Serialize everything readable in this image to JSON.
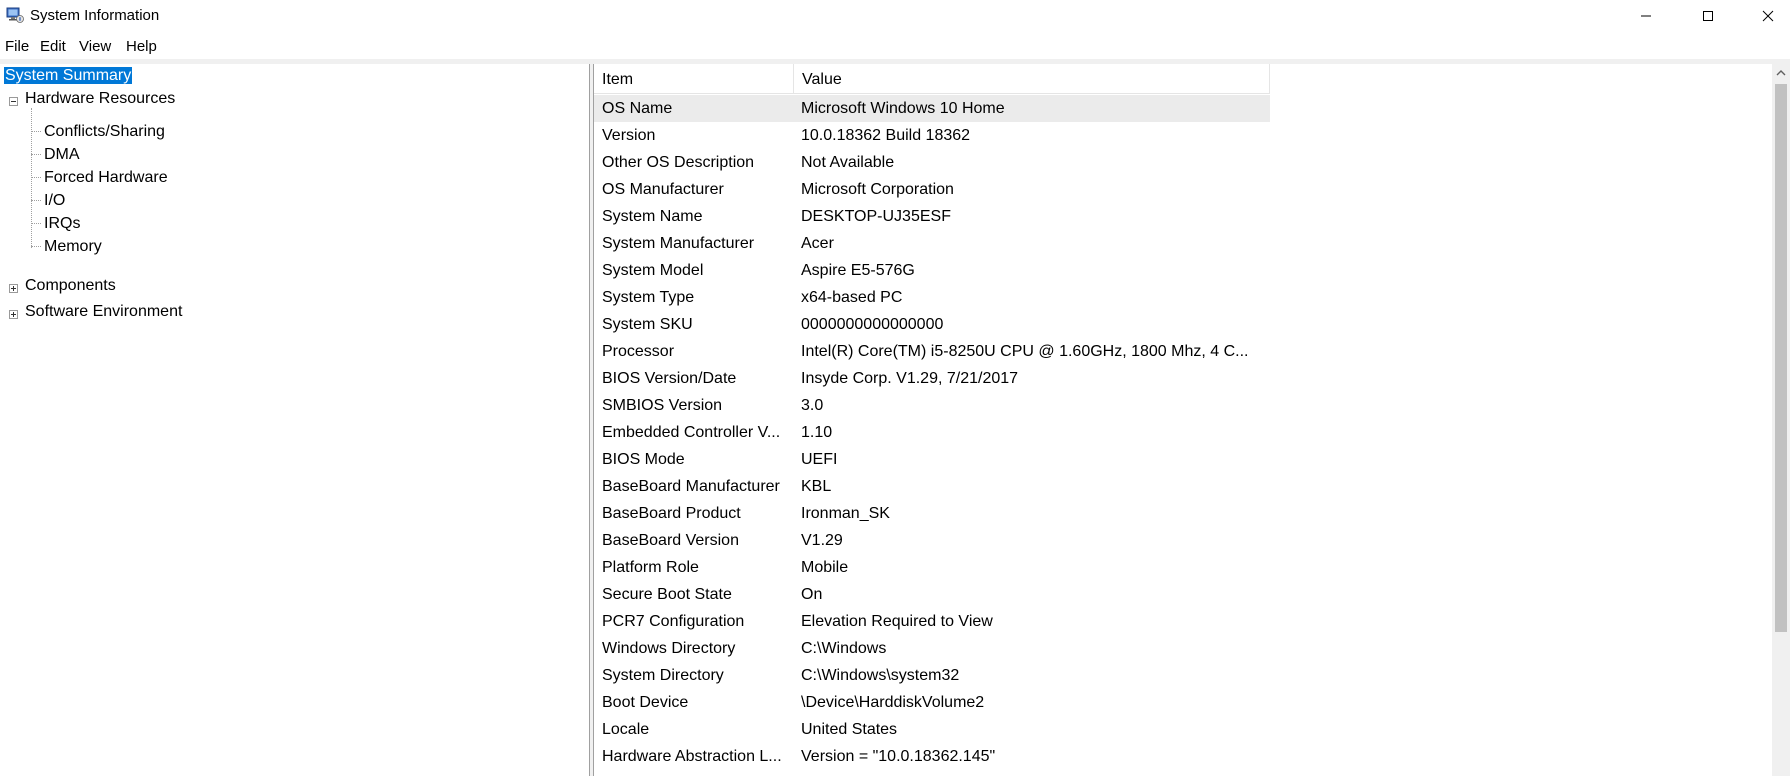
{
  "window": {
    "title": "System Information"
  },
  "menu": [
    "File",
    "Edit",
    "View",
    "Help"
  ],
  "tree": {
    "root": "System Summary",
    "hardware": "Hardware Resources",
    "hardware_children": [
      "Conflicts/Sharing",
      "DMA",
      "Forced Hardware",
      "I/O",
      "IRQs",
      "Memory"
    ],
    "components": "Components",
    "software": "Software Environment"
  },
  "list": {
    "headers": {
      "item": "Item",
      "value": "Value"
    },
    "rows": [
      {
        "item": "OS Name",
        "value": "Microsoft Windows 10 Home"
      },
      {
        "item": "Version",
        "value": "10.0.18362 Build 18362"
      },
      {
        "item": "Other OS Description",
        "value": "Not Available"
      },
      {
        "item": "OS Manufacturer",
        "value": "Microsoft Corporation"
      },
      {
        "item": "System Name",
        "value": "DESKTOP-UJ35ESF"
      },
      {
        "item": "System Manufacturer",
        "value": "Acer"
      },
      {
        "item": "System Model",
        "value": "Aspire E5-576G"
      },
      {
        "item": "System Type",
        "value": "x64-based PC"
      },
      {
        "item": "System SKU",
        "value": "0000000000000000"
      },
      {
        "item": "Processor",
        "value": "Intel(R) Core(TM) i5-8250U CPU @ 1.60GHz, 1800 Mhz, 4 C..."
      },
      {
        "item": "BIOS Version/Date",
        "value": "Insyde Corp. V1.29, 7/21/2017"
      },
      {
        "item": "SMBIOS Version",
        "value": "3.0"
      },
      {
        "item": "Embedded Controller V...",
        "value": "1.10"
      },
      {
        "item": "BIOS Mode",
        "value": "UEFI"
      },
      {
        "item": "BaseBoard Manufacturer",
        "value": "KBL"
      },
      {
        "item": "BaseBoard Product",
        "value": "Ironman_SK"
      },
      {
        "item": "BaseBoard Version",
        "value": "V1.29"
      },
      {
        "item": "Platform Role",
        "value": "Mobile"
      },
      {
        "item": "Secure Boot State",
        "value": "On"
      },
      {
        "item": "PCR7 Configuration",
        "value": "Elevation Required to View"
      },
      {
        "item": "Windows Directory",
        "value": "C:\\Windows"
      },
      {
        "item": "System Directory",
        "value": "C:\\Windows\\system32"
      },
      {
        "item": "Boot Device",
        "value": "\\Device\\HarddiskVolume2"
      },
      {
        "item": "Locale",
        "value": "United States"
      },
      {
        "item": "Hardware Abstraction L...",
        "value": "Version = \"10.0.18362.145\""
      }
    ]
  },
  "colors": {
    "selection": "#0078d7",
    "row_highlight": "#ebebeb"
  },
  "icons": {
    "app": "system-information-icon",
    "minimize": "minimize-icon",
    "maximize": "maximize-icon",
    "close": "close-icon",
    "scroll_up": "chevron-up-icon"
  }
}
